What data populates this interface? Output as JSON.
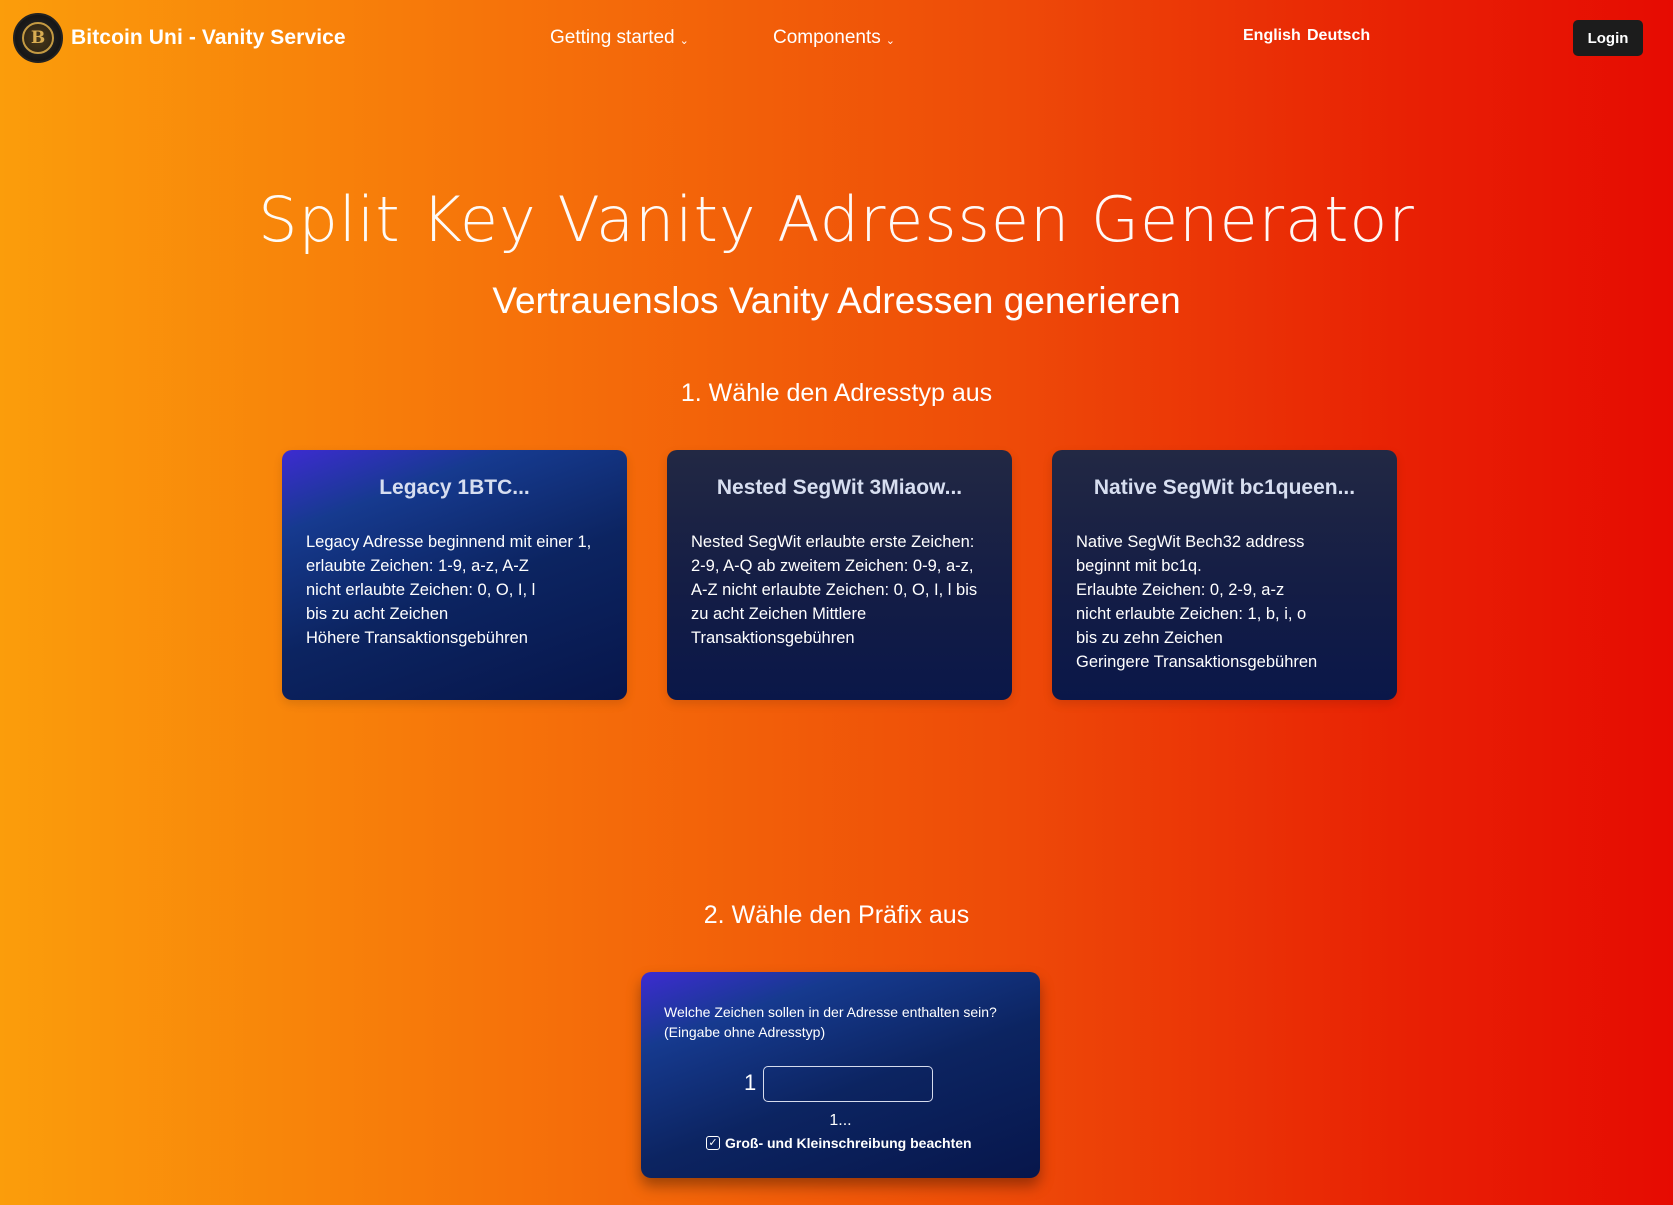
{
  "navbar": {
    "brand_logo_letter": "B",
    "brand_title": "Bitcoin Uni - Vanity Service",
    "menu": [
      {
        "label": "Getting started",
        "chevron": "⌄"
      },
      {
        "label": "Components",
        "chevron": "⌄"
      }
    ],
    "languages": [
      "English",
      "Deutsch"
    ],
    "login_label": "Login"
  },
  "hero": {
    "title": "Split Key Vanity Adressen Generator",
    "subtitle": "Vertrauenslos Vanity Adressen generieren"
  },
  "step1": {
    "heading": "1. Wähle den Adresstyp aus",
    "cards": [
      {
        "title": "Legacy 1BTC...",
        "lines": [
          "Legacy Adresse beginnend mit einer 1,",
          "erlaubte Zeichen: 1-9, a-z, A-Z",
          "nicht erlaubte Zeichen: 0, O, I, l",
          "bis zu acht Zeichen",
          "Höhere Transaktionsgebühren"
        ]
      },
      {
        "title": "Nested SegWit 3Miaow...",
        "lines": [
          "Nested SegWit erlaubte erste Zeichen:",
          "2-9, A-Q ab zweitem Zeichen: 0-9, a-z,",
          "A-Z nicht erlaubte Zeichen: 0, O, I, l bis",
          "zu acht Zeichen Mittlere",
          "Transaktionsgebühren"
        ]
      },
      {
        "title": "Native SegWit bc1queen...",
        "lines": [
          "Native SegWit Bech32 address",
          "beginnt mit bc1q.",
          "Erlaubte Zeichen: 0, 2-9, a-z",
          "nicht erlaubte Zeichen: 1, b, i, o",
          "bis zu zehn Zeichen",
          "Geringere Transaktionsgebühren"
        ]
      }
    ]
  },
  "step2": {
    "heading": "2. Wähle den Präfix aus",
    "question_lines": [
      "Welche Zeichen sollen in der Adresse enthalten sein?",
      "(Eingabe ohne Adresstyp)"
    ],
    "prefix_char": "1",
    "input_value": "",
    "input_placeholder": "",
    "preview": "1...",
    "case_sensitive_label": "Groß- und Kleinschreibung beachten",
    "case_sensitive_checked": true,
    "checkmark": "✓"
  }
}
